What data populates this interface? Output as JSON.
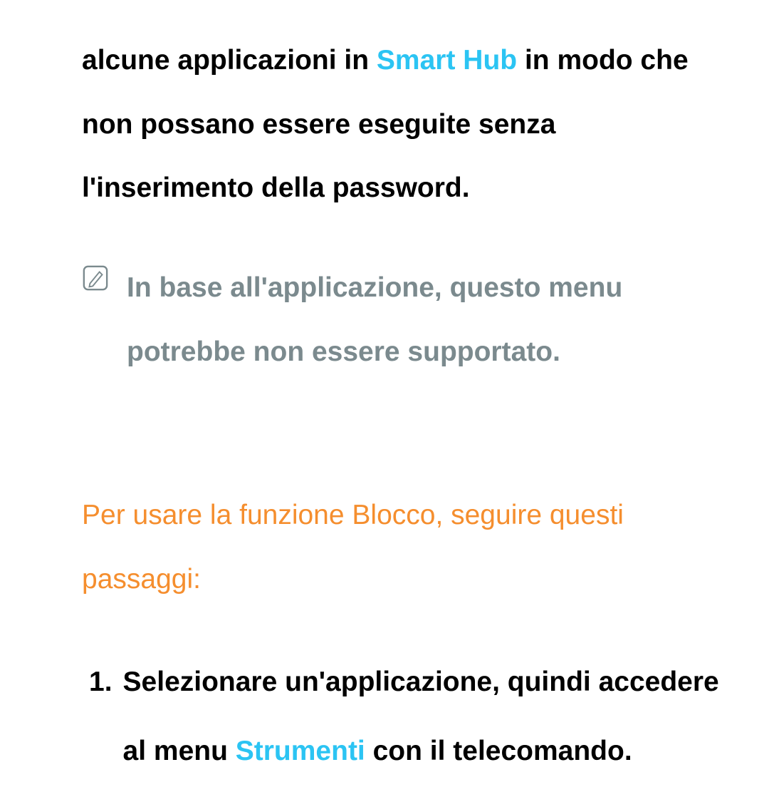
{
  "paragraph1": {
    "part1": "alcune applicazioni in ",
    "highlight": "Smart Hub",
    "part2": " in modo che non possano essere eseguite senza l'inserimento della password."
  },
  "note": {
    "text": "In base all'applicazione, questo menu potrebbe non essere supportato."
  },
  "section_heading": "Per usare la funzione Blocco, seguire questi passaggi:",
  "steps": [
    {
      "number": "1.",
      "part1": "Selezionare un'applicazione, quindi accedere al menu ",
      "highlight": "Strumenti",
      "part2": " con il telecomando."
    }
  ]
}
